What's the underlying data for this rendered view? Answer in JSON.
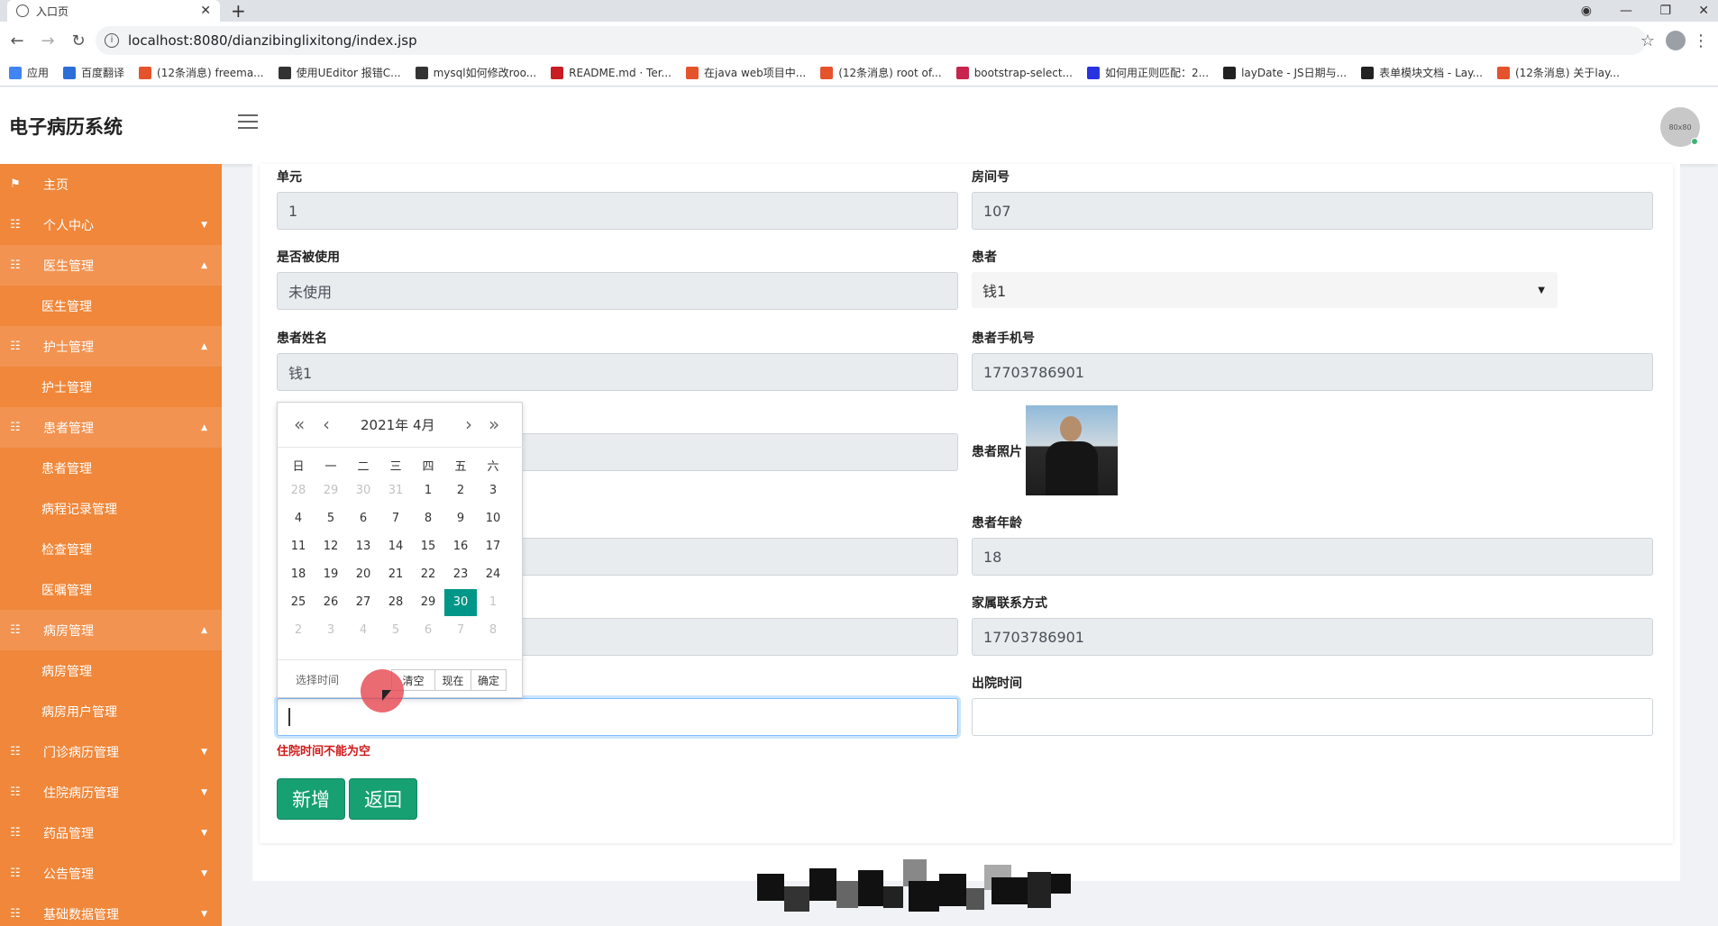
{
  "browser": {
    "tab_title": "入口页",
    "tab_close": "✕",
    "new_tab": "+",
    "url": "localhost:8080/dianzibinglixitong/index.jsp",
    "bookmarks": [
      {
        "label": "应用",
        "color": "#4285f4"
      },
      {
        "label": "百度翻译",
        "color": "#2d6fd8"
      },
      {
        "label": "(12条消息) freema...",
        "color": "#e5532d"
      },
      {
        "label": "使用UEditor 报错C...",
        "color": "#333333"
      },
      {
        "label": "mysql如何修改roo...",
        "color": "#333333"
      },
      {
        "label": "README.md · Ter...",
        "color": "#c71d23"
      },
      {
        "label": "在java web项目中...",
        "color": "#e5532d"
      },
      {
        "label": "(12条消息) root of...",
        "color": "#e5532d"
      },
      {
        "label": "bootstrap-select...",
        "color": "#c7254e"
      },
      {
        "label": "如何用正则匹配：2...",
        "color": "#2932e1"
      },
      {
        "label": "layDate - JS日期与...",
        "color": "#222222"
      },
      {
        "label": "表单模块文档 - Lay...",
        "color": "#222222"
      },
      {
        "label": "(12条消息) 关于lay...",
        "color": "#e5532d"
      }
    ]
  },
  "header": {
    "brand": "电子病历系统",
    "avatar_text": "80x80"
  },
  "sidebar": {
    "items": [
      {
        "label": "主页",
        "type": "parent",
        "icon": "⚑",
        "caret": ""
      },
      {
        "label": "个人中心",
        "type": "parent",
        "icon": "☷",
        "caret": "▼"
      },
      {
        "label": "医生管理",
        "type": "open",
        "icon": "☷",
        "caret": "▲"
      },
      {
        "label": "医生管理",
        "type": "child",
        "icon": "",
        "caret": ""
      },
      {
        "label": "护士管理",
        "type": "open",
        "icon": "☷",
        "caret": "▲"
      },
      {
        "label": "护士管理",
        "type": "child",
        "icon": "",
        "caret": ""
      },
      {
        "label": "患者管理",
        "type": "open",
        "icon": "☷",
        "caret": "▲"
      },
      {
        "label": "患者管理",
        "type": "child",
        "icon": "",
        "caret": ""
      },
      {
        "label": "病程记录管理",
        "type": "child",
        "icon": "",
        "caret": ""
      },
      {
        "label": "检查管理",
        "type": "child",
        "icon": "",
        "caret": ""
      },
      {
        "label": "医嘱管理",
        "type": "child",
        "icon": "",
        "caret": ""
      },
      {
        "label": "病房管理",
        "type": "open",
        "icon": "☷",
        "caret": "▲"
      },
      {
        "label": "病房管理",
        "type": "child",
        "icon": "",
        "caret": ""
      },
      {
        "label": "病房用户管理",
        "type": "child",
        "icon": "",
        "caret": ""
      },
      {
        "label": "门诊病历管理",
        "type": "parent",
        "icon": "☷",
        "caret": "▼"
      },
      {
        "label": "住院病历管理",
        "type": "parent",
        "icon": "☷",
        "caret": "▼"
      },
      {
        "label": "药品管理",
        "type": "parent",
        "icon": "☷",
        "caret": "▼"
      },
      {
        "label": "公告管理",
        "type": "parent",
        "icon": "☷",
        "caret": "▼"
      },
      {
        "label": "基础数据管理",
        "type": "parent",
        "icon": "☷",
        "caret": "▼"
      }
    ]
  },
  "form": {
    "unit_label": "单元",
    "unit_value": "1",
    "room_label": "房间号",
    "room_value": "107",
    "used_label": "是否被使用",
    "used_value": "未使用",
    "patient_label": "患者",
    "patient_value": "钱1",
    "patient_name_label": "患者姓名",
    "patient_name_value": "钱1",
    "patient_phone_label": "患者手机号",
    "patient_phone_value": "17703786901",
    "patient_photo_label": "患者照片",
    "patient_age_label": "患者年龄",
    "patient_age_value": "18",
    "family_contact_label": "家属联系方式",
    "family_contact_value": "17703786901",
    "discharge_label": "出院时间",
    "admission_error": "住院时间不能为空",
    "add_button": "新增",
    "back_button": "返回"
  },
  "datepicker": {
    "year_month": "2021年 4月",
    "weekdays": [
      "日",
      "一",
      "二",
      "三",
      "四",
      "五",
      "六"
    ],
    "weeks": [
      [
        "28",
        "29",
        "30",
        "31",
        "1",
        "2",
        "3"
      ],
      [
        "4",
        "5",
        "6",
        "7",
        "8",
        "9",
        "10"
      ],
      [
        "11",
        "12",
        "13",
        "14",
        "15",
        "16",
        "17"
      ],
      [
        "18",
        "19",
        "20",
        "21",
        "22",
        "23",
        "24"
      ],
      [
        "25",
        "26",
        "27",
        "28",
        "29",
        "30",
        "1"
      ],
      [
        "2",
        "3",
        "4",
        "5",
        "6",
        "7",
        "8"
      ]
    ],
    "selected": "30",
    "pick_time": "选择时间",
    "clear": "清空",
    "now": "现在",
    "confirm": "确定"
  }
}
